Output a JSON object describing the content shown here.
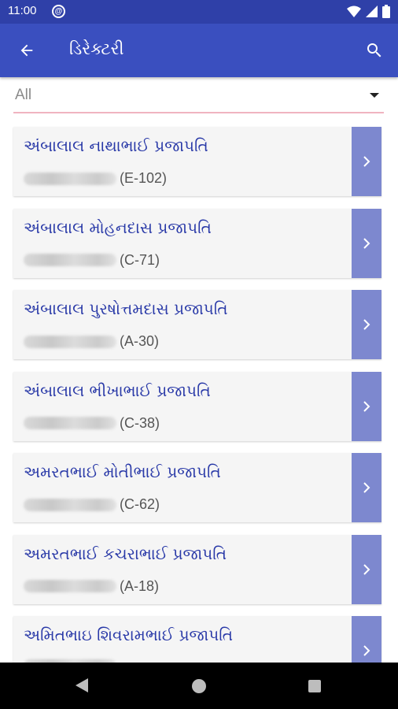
{
  "status_bar": {
    "time": "11:00",
    "notification_glyph": "@"
  },
  "app_bar": {
    "title": "ડિરેક્ટરી",
    "back_icon": "arrow-left-icon",
    "search_icon": "search-icon"
  },
  "filter": {
    "selected": "All"
  },
  "members": [
    {
      "name": "અંબાલાલ નાથાભાઈ પ્રજાપતિ",
      "code": "(E-102)"
    },
    {
      "name": "અંબાલાલ મોહનદાસ પ્રજાપતિ",
      "code": "(C-71)"
    },
    {
      "name": "અંબાલાલ પુરષોત્તમદાસ પ્રજાપતિ",
      "code": "(A-30)"
    },
    {
      "name": "અંબાલાલ ભીખાભાઈ પ્રજાપતિ",
      "code": "(C-38)"
    },
    {
      "name": "અમરતભાઈ  મોતીભાઈ પ્રજાપતિ",
      "code": "(C-62)"
    },
    {
      "name": "અમરતભાઈ  કચરાભાઈ  પ્રજાપતિ",
      "code": "(A-18)"
    },
    {
      "name": "અમિતભાઇ  શિવરામભાઈ  પ્રજાપતિ",
      "code": ""
    }
  ],
  "colors": {
    "app_bar": "#3a4fbf",
    "status_bar": "#2f40a8",
    "name_text": "#2a3aa8",
    "arrow_tab": "#7d88cf",
    "filter_underline": "#f0b4c0"
  }
}
